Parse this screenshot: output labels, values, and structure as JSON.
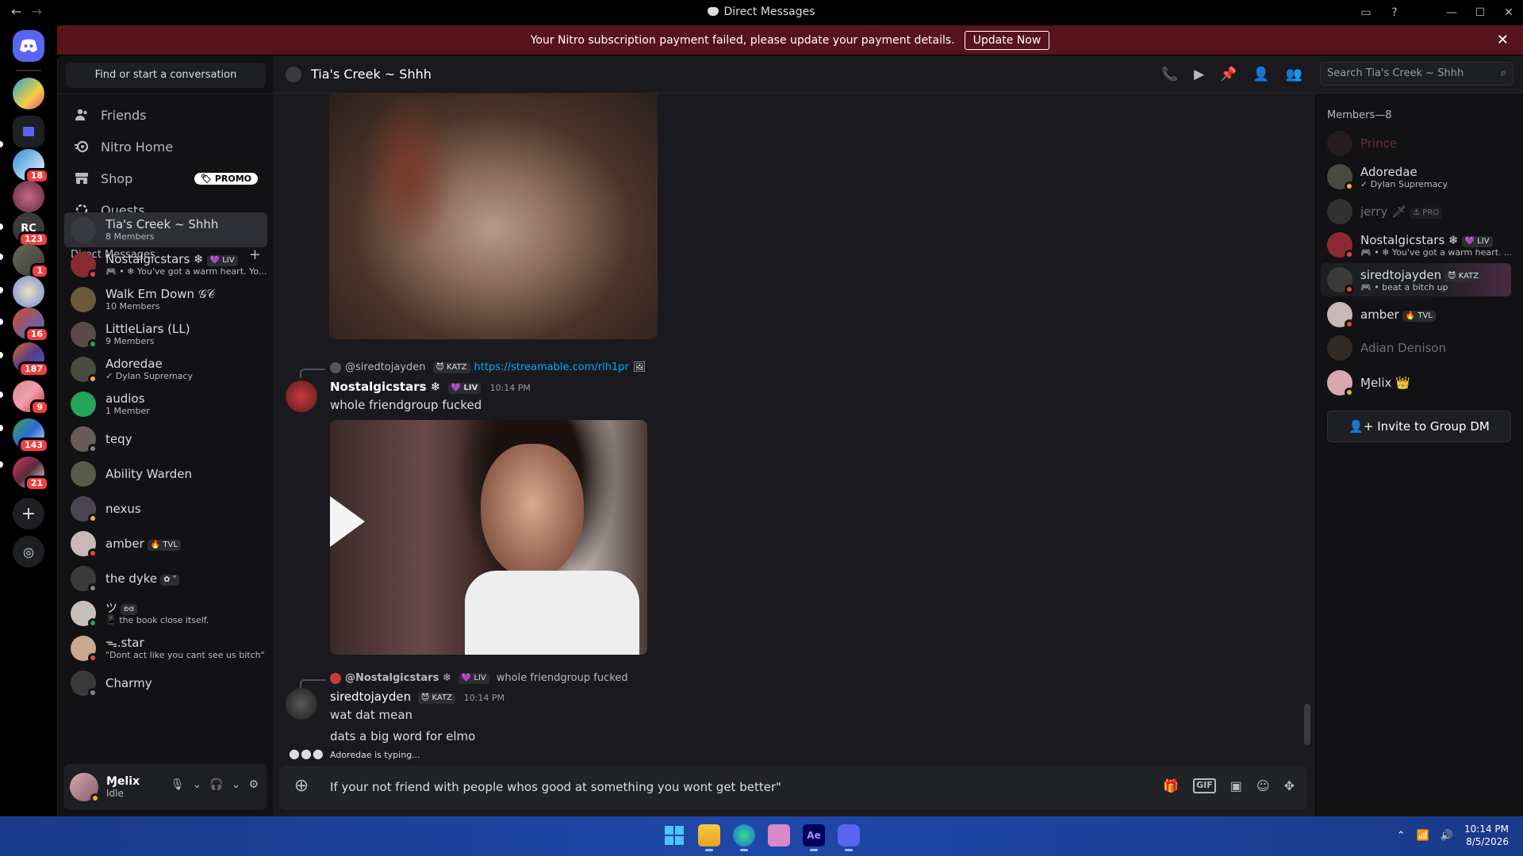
{
  "window": {
    "title": "Direct Messages"
  },
  "banner": {
    "message": "Your Nitro subscription payment failed, please update your payment details.",
    "action": "Update Now"
  },
  "rail": {
    "badges": [
      "18",
      "123",
      "1",
      "16",
      "187",
      "9",
      "143",
      "21"
    ]
  },
  "sidebar": {
    "find_label": "Find or start a conversation",
    "nav": [
      {
        "label": "Friends",
        "icon": "friends-icon"
      },
      {
        "label": "Nitro Home",
        "icon": "nitro-icon"
      },
      {
        "label": "Shop",
        "icon": "shop-icon",
        "badge": "PROMO"
      },
      {
        "label": "Quests",
        "icon": "quests-icon"
      }
    ],
    "dm_header": "Direct Messages",
    "dms": [
      {
        "name": "Tia's Creek ~ Shhh",
        "sub": "8 Members",
        "color": "#3a3b40"
      },
      {
        "name": "Nostalgicstars ❄",
        "tag": "💜 LIV",
        "sub": "🎮 • ❄ You've got a warm heart. Yo...",
        "color": "#8a2a30",
        "status": "#f23f43"
      },
      {
        "name": "Walk Em Down 𝒢𝒞",
        "sub": "10 Members",
        "color": "#6a5a3a"
      },
      {
        "name": "LittleLiars (LL)",
        "sub": "9 Members",
        "color": "#5a4a4a",
        "status": "#23a55a"
      },
      {
        "name": "Adoredae",
        "sub": "✓ Dylan Supremacy",
        "color": "#4a4a40",
        "status": "#f0b232"
      },
      {
        "name": "audios",
        "sub": "1 Member",
        "color": "#23a55a"
      },
      {
        "name": "teqy",
        "sub": "",
        "color": "#6a5a58",
        "status": "#80848e"
      },
      {
        "name": "Ability Warden",
        "sub": "",
        "color": "#5a5a4a"
      },
      {
        "name": "nexus",
        "sub": "",
        "color": "#4a4450",
        "status": "#f0b232"
      },
      {
        "name": "amber",
        "tag": "🔥 TVL",
        "sub": "",
        "color": "#c8b8b8",
        "status": "#f23f43"
      },
      {
        "name": "the dyke",
        "tag": "✿ ʺ",
        "sub": "",
        "color": "#3a3a3a",
        "status": "#80848e"
      },
      {
        "name": "ツ",
        "tag": "ʚɞ",
        "sub": "📱 the book close itself.",
        "color": "#c8c0bc",
        "status": "#23a55a"
      },
      {
        "name": "ᯓ.star",
        "sub": "\"Dont act like you cant see us bitch\"",
        "color": "#c8a890",
        "status": "#f23f43"
      },
      {
        "name": "Charmy",
        "sub": "",
        "color": "#3a3a3a",
        "status": "#80848e"
      }
    ]
  },
  "user": {
    "name": "Ɱelix",
    "status": "Idle"
  },
  "chat": {
    "channel": "Tia's Creek ~ Shhh",
    "search_placeholder": "Search Tia's Creek ~ Shhh",
    "msg1": {
      "reply_user": "@siredtojayden",
      "reply_tag": "😈 KATZ",
      "reply_link": "https://streamable.com/rlh1pr",
      "author": "Nostalgicstars ❄",
      "author_tag": "💜 LIV",
      "time": "10:14 PM",
      "text": "whole friendgroup fucked"
    },
    "msg2": {
      "reply_user": "@Nostalgicstars ❄",
      "reply_tag": "💜 LIV",
      "reply_text": "whole friendgroup fucked",
      "author": "siredtojayden",
      "author_tag": "😈 KATZ",
      "time": "10:14 PM",
      "lines": [
        "wat dat mean",
        "dats a big word for elmo"
      ]
    },
    "typing": "Adoredae is typing...",
    "composer_value": "If your not friend with people whos good at something you wont get better\""
  },
  "members": {
    "header": "Members—8",
    "list": [
      {
        "name": "Prince",
        "sub": "",
        "dim": true,
        "color": "#3a2a28",
        "name_color": "#c84a6a"
      },
      {
        "name": "Adoredae",
        "sub": "✓ Dylan Supremacy",
        "color": "#4a4a40",
        "status": "#f0b232"
      },
      {
        "name": "jerry 🗡",
        "tag": "⚓ PRO",
        "sub": "",
        "dim": true,
        "color": "#5a5a5a"
      },
      {
        "name": "Nostalgicstars ❄",
        "tag": "💜 LIV",
        "sub": "🎮 • ❄ You've got a warm heart. ...",
        "color": "#8a2a30",
        "status": "#f23f43"
      },
      {
        "name": "siredtojayden",
        "tag": "😈 KATZ",
        "sub": "🎮 • beat a bitch up",
        "color": "#3a3a3a",
        "status": "#f23f43"
      },
      {
        "name": "amber",
        "tag": "🔥 TVL",
        "sub": "",
        "color": "#c8b8b8",
        "status": "#f23f43"
      },
      {
        "name": "Adian Denison",
        "sub": "",
        "dim": true,
        "color": "#5a4a3a"
      },
      {
        "name": "Ɱelix 👑",
        "sub": "",
        "color": "#d8a7b1",
        "status": "#f0b232"
      }
    ],
    "invite": "Invite to Group DM"
  },
  "taskbar": {
    "time": "10:14 PM",
    "date": "8/5/2026"
  }
}
